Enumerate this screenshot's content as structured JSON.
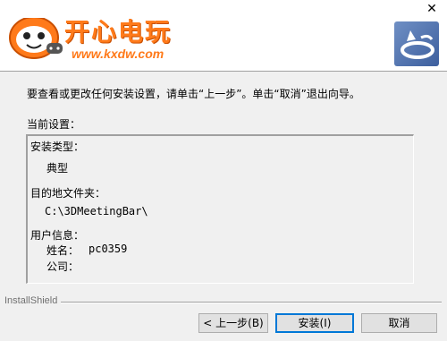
{
  "window": {
    "close_glyph": "✕"
  },
  "banner": {
    "logo_text": "开心电玩",
    "logo_url": "www.kxdw.com",
    "setup_icon": "installshield-setup-icon"
  },
  "content": {
    "instruction": "要查看或更改任何安装设置，请单击“上一步”。单击“取消”退出向导。",
    "settings_label": "当前设置：",
    "settings": {
      "install_type_label": "安装类型：",
      "install_type_value": "典型",
      "destination_label": "目的地文件夹：",
      "destination_value": "C:\\3DMeetingBar\\",
      "user_info_label": "用户信息：",
      "name_label": "姓名：",
      "name_value": "pc0359",
      "company_label": "公司："
    }
  },
  "footer": {
    "brand": "InstallShield",
    "back_label": "< 上一步(B)",
    "install_label": "安装(I)",
    "cancel_label": "取消"
  },
  "colors": {
    "logo_orange": "#ff7a1a",
    "default_button_border": "#0078d7",
    "dialog_bg": "#f0f0f0"
  }
}
